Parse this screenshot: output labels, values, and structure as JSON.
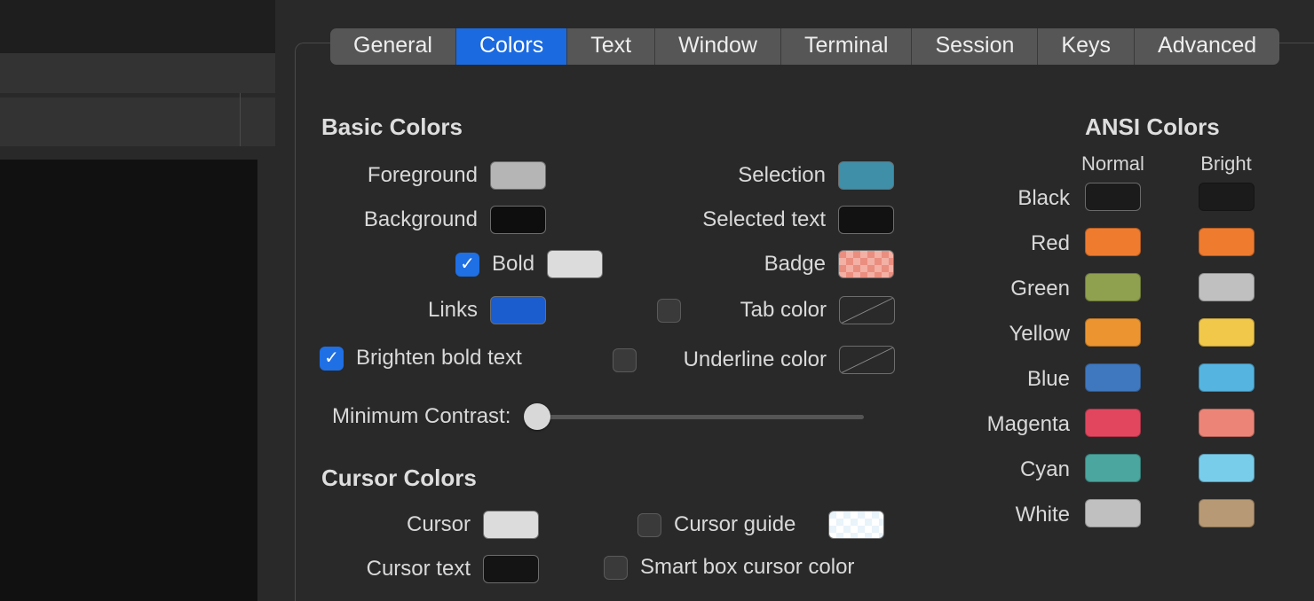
{
  "tabs": [
    {
      "label": "General"
    },
    {
      "label": "Colors"
    },
    {
      "label": "Text"
    },
    {
      "label": "Window"
    },
    {
      "label": "Terminal"
    },
    {
      "label": "Session"
    },
    {
      "label": "Keys"
    },
    {
      "label": "Advanced"
    }
  ],
  "active_tab": "Colors",
  "sections": {
    "basic": "Basic Colors",
    "cursor": "Cursor Colors",
    "ansi": "ANSI Colors"
  },
  "basic": {
    "foreground_label": "Foreground",
    "foreground_color": "#b5b5b5",
    "background_label": "Background",
    "background_color": "#0e0e0e",
    "bold_label": "Bold",
    "bold_color": "#dcdcdc",
    "bold_checked": true,
    "links_label": "Links",
    "links_color": "#1b5ccf",
    "brighten_label": "Brighten bold text",
    "brighten_checked": true,
    "minimum_contrast_label": "Minimum Contrast:",
    "selection_label": "Selection",
    "selection_color": "#3f8fa8",
    "selected_text_label": "Selected text",
    "selected_text_color": "#121212",
    "badge_label": "Badge",
    "tab_color_label": "Tab color",
    "tab_color_checked": false,
    "underline_color_label": "Underline color",
    "underline_color_checked": false
  },
  "cursor": {
    "cursor_label": "Cursor",
    "cursor_color": "#dcdcdc",
    "cursor_text_label": "Cursor text",
    "cursor_text_color": "#141414",
    "cursor_guide_label": "Cursor guide",
    "cursor_guide_checked": false,
    "smart_box_label": "Smart box cursor color",
    "smart_box_checked": false
  },
  "ansi": {
    "normal_head": "Normal",
    "bright_head": "Bright",
    "rows": [
      {
        "label": "Black",
        "normal": "#1b1b1b",
        "bright": "#1b1b1b",
        "normal_outlined": true
      },
      {
        "label": "Red",
        "normal": "#ef7b2f",
        "bright": "#ef7b2f"
      },
      {
        "label": "Green",
        "normal": "#8fa04f",
        "bright": "#c0c0c0"
      },
      {
        "label": "Yellow",
        "normal": "#ec9530",
        "bright": "#f2c84b"
      },
      {
        "label": "Blue",
        "normal": "#3f78bf",
        "bright": "#55b5e0"
      },
      {
        "label": "Magenta",
        "normal": "#e2465f",
        "bright": "#ec8578"
      },
      {
        "label": "Cyan",
        "normal": "#4aa69e",
        "bright": "#78cdeb"
      },
      {
        "label": "White",
        "normal": "#c0c0c0",
        "bright": "#b79a75"
      }
    ]
  }
}
